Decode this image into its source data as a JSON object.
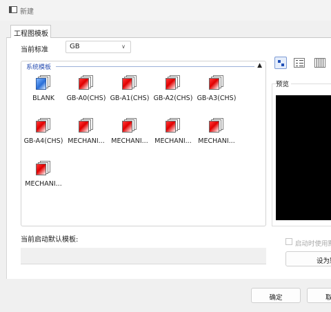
{
  "window": {
    "title": "新建"
  },
  "tabs": [
    {
      "label": "工程图模板"
    }
  ],
  "standard": {
    "label": "当前标准",
    "value": "GB"
  },
  "templates": {
    "group_label": "系统模板",
    "items": [
      {
        "label": "BLANK",
        "kind": "blank"
      },
      {
        "label": "GB-A0(CHS)",
        "kind": "drawing"
      },
      {
        "label": "GB-A1(CHS)",
        "kind": "drawing"
      },
      {
        "label": "GB-A2(CHS)",
        "kind": "drawing"
      },
      {
        "label": "GB-A3(CHS)",
        "kind": "drawing"
      },
      {
        "label": "GB-A4(CHS)",
        "kind": "drawing"
      },
      {
        "label": "MECHANI...",
        "kind": "drawing"
      },
      {
        "label": "MECHANI...",
        "kind": "drawing"
      },
      {
        "label": "MECHANI...",
        "kind": "drawing"
      },
      {
        "label": "MECHANI...",
        "kind": "drawing"
      },
      {
        "label": "MECHANI...",
        "kind": "drawing"
      }
    ]
  },
  "view_modes": [
    "large-icons",
    "list",
    "details"
  ],
  "preview": {
    "label": "预览"
  },
  "default_template": {
    "label": "当前启动默认模板:",
    "value": ""
  },
  "startup": {
    "label": "启动时使用默",
    "checked": false
  },
  "buttons": {
    "set_as": "设为默",
    "ok": "确定",
    "cancel": "取消"
  },
  "colors": {
    "accent": "#2a4fb2",
    "icon_red": "#e10000",
    "icon_blue": "#2a6fd8"
  }
}
